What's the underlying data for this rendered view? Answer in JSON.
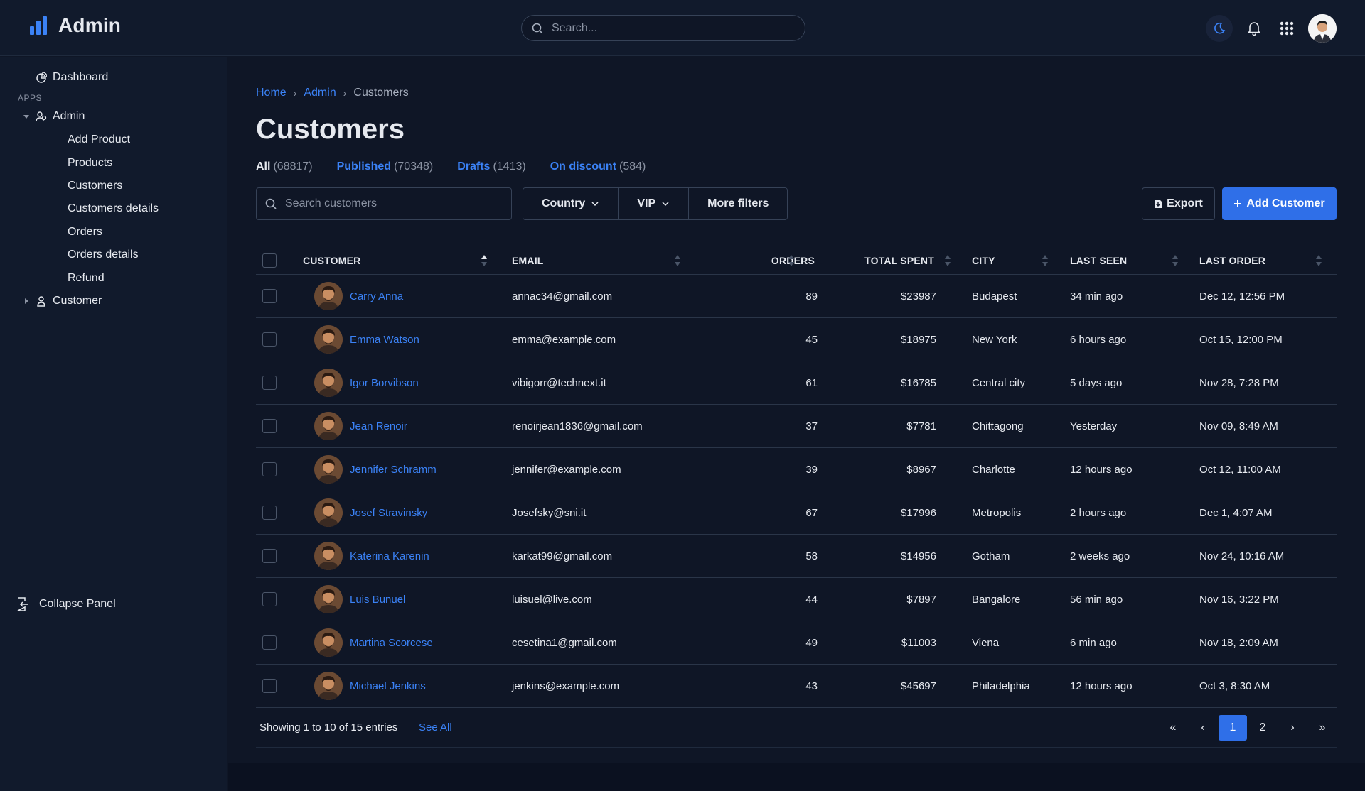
{
  "app": {
    "title": "Admin"
  },
  "topbar": {
    "search_placeholder": "Search..."
  },
  "sidebar": {
    "dashboard": "Dashboard",
    "apps_label": "APPS",
    "admin": "Admin",
    "admin_items": [
      "Add Product",
      "Products",
      "Customers",
      "Customers details",
      "Orders",
      "Orders details",
      "Refund"
    ],
    "customer": "Customer",
    "collapse": "Collapse Panel"
  },
  "breadcrumb": {
    "home": "Home",
    "admin": "Admin",
    "current": "Customers"
  },
  "page": {
    "title": "Customers"
  },
  "tabs": [
    {
      "label": "All",
      "count": "(68817)"
    },
    {
      "label": "Published",
      "count": "(70348)"
    },
    {
      "label": "Drafts",
      "count": "(1413)"
    },
    {
      "label": "On discount",
      "count": "(584)"
    }
  ],
  "toolbar": {
    "search_placeholder": "Search customers",
    "country": "Country",
    "vip": "VIP",
    "more_filters": "More filters",
    "export": "Export",
    "add_customer": "Add Customer"
  },
  "table": {
    "headers": [
      "CUSTOMER",
      "EMAIL",
      "ORDERS",
      "TOTAL SPENT",
      "CITY",
      "LAST SEEN",
      "LAST ORDER"
    ],
    "rows": [
      [
        "Carry Anna",
        "annac34@gmail.com",
        "89",
        "$23987",
        "Budapest",
        "34 min ago",
        "Dec 12, 12:56 PM"
      ],
      [
        "Emma Watson",
        "emma@example.com",
        "45",
        "$18975",
        "New York",
        "6 hours ago",
        "Oct 15, 12:00 PM"
      ],
      [
        "Igor Borvibson",
        "vibigorr@technext.it",
        "61",
        "$16785",
        "Central city",
        "5 days ago",
        "Nov 28, 7:28 PM"
      ],
      [
        "Jean Renoir",
        "renoirjean1836@gmail.com",
        "37",
        "$7781",
        "Chittagong",
        "Yesterday",
        "Nov 09, 8:49 AM"
      ],
      [
        "Jennifer Schramm",
        "jennifer@example.com",
        "39",
        "$8967",
        "Charlotte",
        "12 hours ago",
        "Oct 12, 11:00 AM"
      ],
      [
        "Josef Stravinsky",
        "Josefsky@sni.it",
        "67",
        "$17996",
        "Metropolis",
        "2 hours ago",
        "Dec 1, 4:07 AM"
      ],
      [
        "Katerina Karenin",
        "karkat99@gmail.com",
        "58",
        "$14956",
        "Gotham",
        "2 weeks ago",
        "Nov 24, 10:16 AM"
      ],
      [
        "Luis Bunuel",
        "luisuel@live.com",
        "44",
        "$7897",
        "Bangalore",
        "56 min ago",
        "Nov 16, 3:22 PM"
      ],
      [
        "Martina Scorcese",
        "cesetina1@gmail.com",
        "49",
        "$11003",
        "Viena",
        "6 min ago",
        "Nov 18, 2:09 AM"
      ],
      [
        "Michael Jenkins",
        "jenkins@example.com",
        "43",
        "$45697",
        "Philadelphia",
        "12 hours ago",
        "Oct 3, 8:30 AM"
      ]
    ]
  },
  "footer": {
    "showing": "Showing 1 to 10 of 15 entries",
    "see_all": "See All",
    "pages": [
      "«",
      "‹",
      "1",
      "2",
      "›",
      "»"
    ],
    "current_page": "1"
  },
  "colors": {
    "accent": "#2f6fe8",
    "link": "#3b82f6",
    "background": "#0f1626",
    "panel": "#111a2c"
  }
}
